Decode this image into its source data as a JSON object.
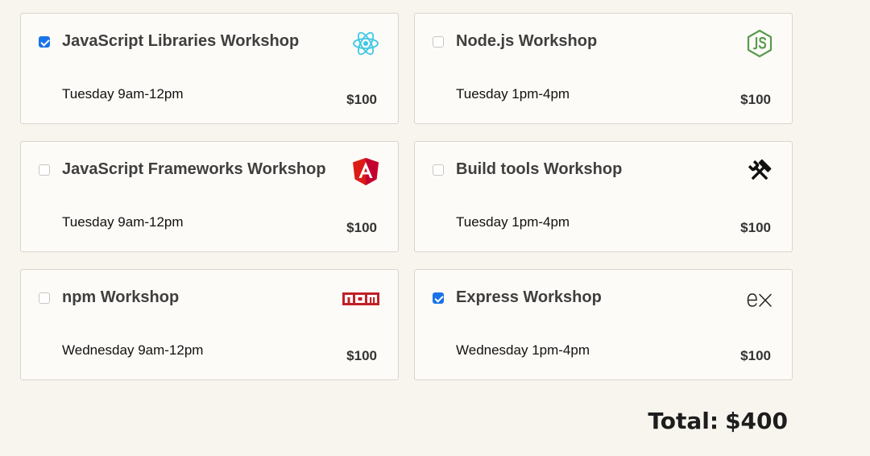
{
  "workshops": [
    {
      "title": "JavaScript Libraries Workshop",
      "time": "Tuesday 9am-12pm",
      "price": "$100",
      "checked": true,
      "icon": "react-icon"
    },
    {
      "title": "Node.js Workshop",
      "time": "Tuesday 1pm-4pm",
      "price": "$100",
      "checked": false,
      "icon": "nodejs-icon"
    },
    {
      "title": "JavaScript Frameworks Workshop",
      "time": "Tuesday 9am-12pm",
      "price": "$100",
      "checked": false,
      "icon": "angular-icon"
    },
    {
      "title": "Build tools Workshop",
      "time": "Tuesday 1pm-4pm",
      "price": "$100",
      "checked": false,
      "icon": "hammer-wrench-icon"
    },
    {
      "title": "npm Workshop",
      "time": "Wednesday 9am-12pm",
      "price": "$100",
      "checked": false,
      "icon": "npm-icon"
    },
    {
      "title": "Express Workshop",
      "time": "Wednesday 1pm-4pm",
      "price": "$100",
      "checked": true,
      "icon": "express-icon"
    }
  ],
  "total": {
    "label": "Total:",
    "value": "$400"
  },
  "colors": {
    "accent": "#1a73e8",
    "background": "#f8f4ee",
    "card": "#fdfbf7",
    "react": "#3fc7e6",
    "node": "#5a9a4f",
    "angular": "#dd1b16",
    "npm": "#c12127"
  }
}
